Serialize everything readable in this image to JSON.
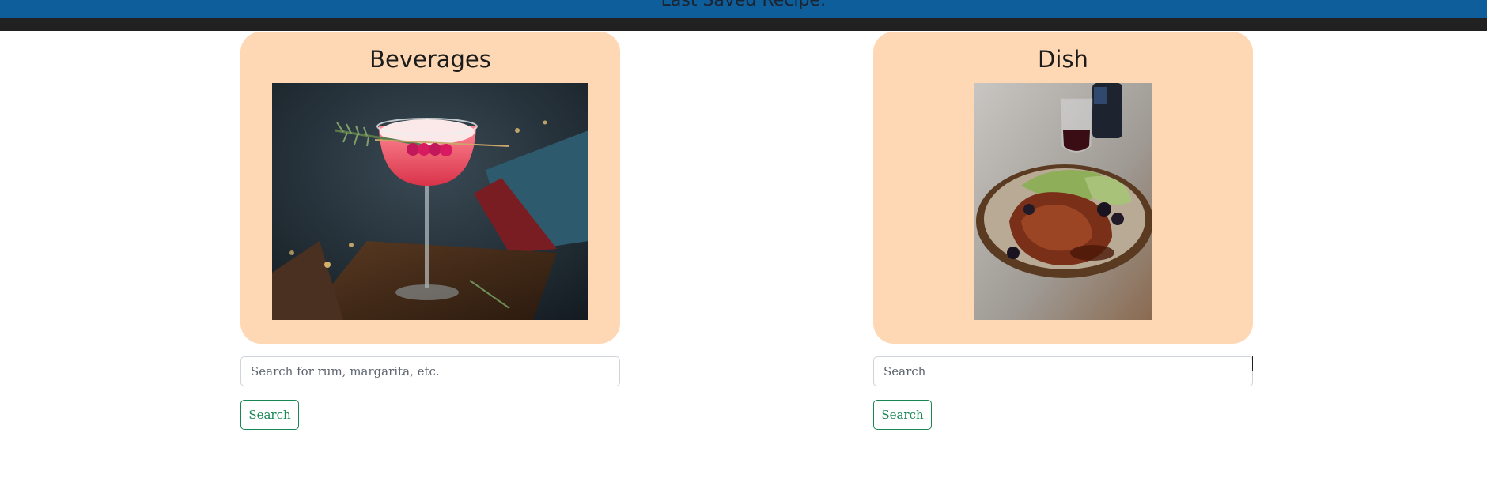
{
  "header": {
    "title": "Last Saved Recipe:"
  },
  "colors": {
    "header_blue": "#0f5e9c",
    "dark_bar": "#212121",
    "card_bg": "#fed8b5",
    "button_green": "#198754"
  },
  "cards": [
    {
      "title": "Beverages",
      "image_icon": "cocktail-photo",
      "search_placeholder": "Search for rum, margarita, etc.",
      "search_value": "",
      "button_label": "Search"
    },
    {
      "title": "Dish",
      "image_icon": "roast-chicken-photo",
      "search_placeholder": "Search",
      "search_value": "",
      "button_label": "Search"
    }
  ]
}
